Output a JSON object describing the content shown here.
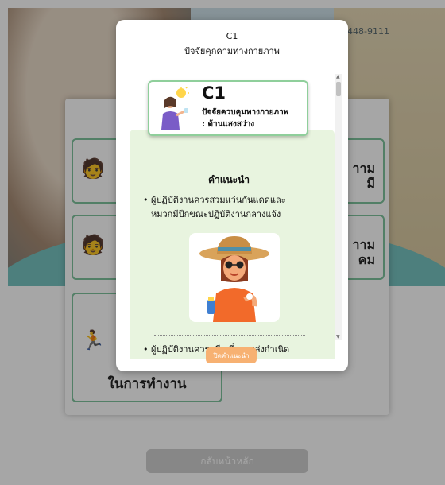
{
  "background": {
    "phone": "448-9111",
    "tiles": [
      {
        "right_text": "าาม\nมี"
      },
      {
        "right_text": "าาม\nคม"
      },
      {
        "bottom_text": "ในการทำงาน"
      }
    ],
    "back_home_label": "กลับหน้าหลัก"
  },
  "modal": {
    "title_code": "C1",
    "title_name": "ปัจจัยคุกคามทางกายภาพ",
    "card": {
      "code": "C1",
      "name": "ปัจจัยควบคุมทางกายภาพ",
      "subname": ": ด้านแสงสว่าง"
    },
    "advice_heading": "คำแนะนำ",
    "advice_items": [
      "ผู้ปฏิบัติงานควรสวมแว่นกันแดดและหมวกมีปีกขณะปฏิบัติงานกลางแจ้ง",
      "ผู้ปฏิบัติงานควรหลีกเลี่ยงแหล่งกำเนิด"
    ],
    "close_label": "ปิดคำแนะนำ"
  },
  "colors": {
    "accent_green": "#8fcf9b",
    "panel_green": "#e8f4df",
    "close_button": "#f7b172",
    "back_home_button": "#cfcfcf"
  }
}
